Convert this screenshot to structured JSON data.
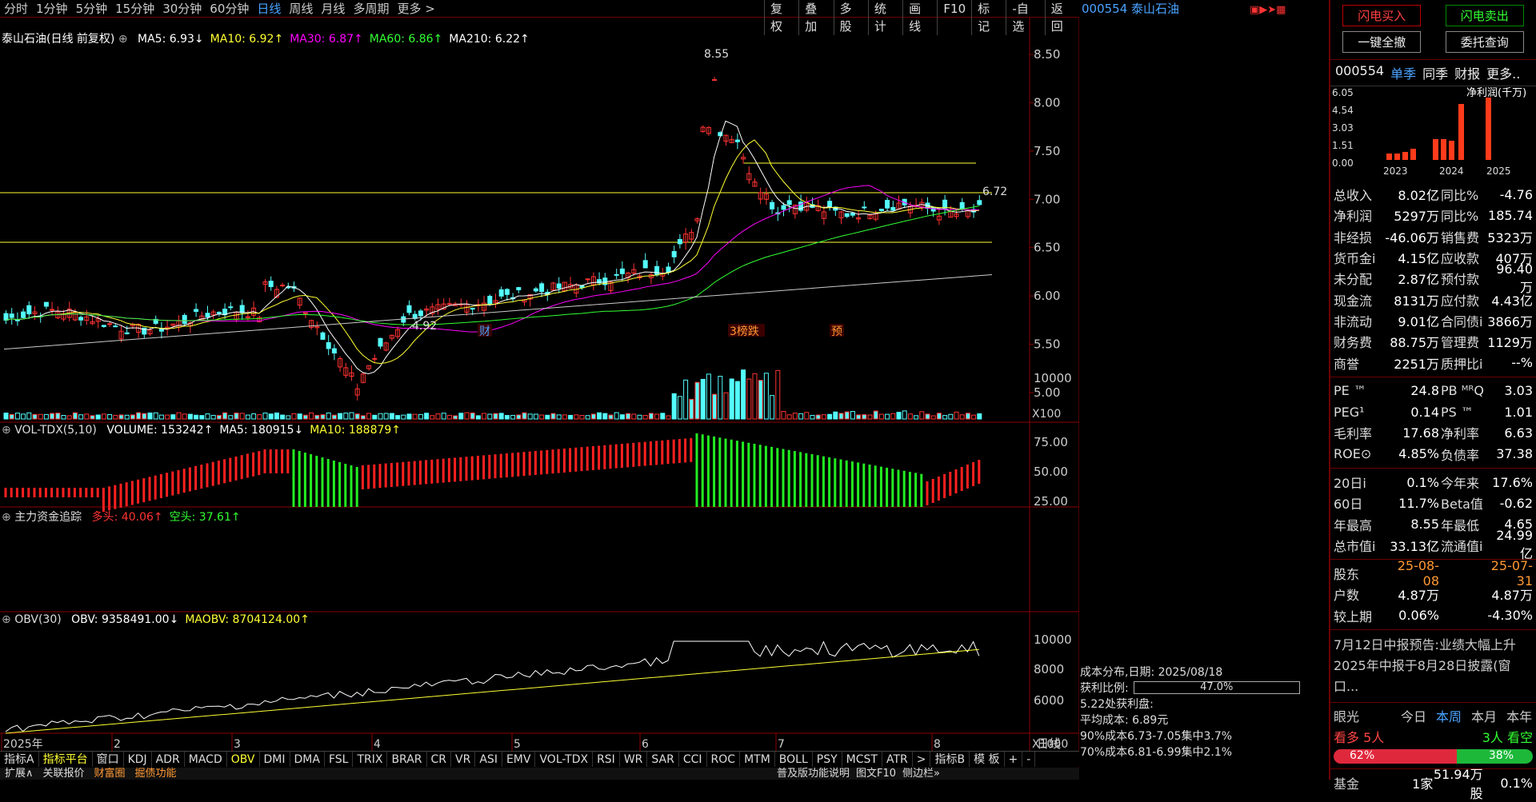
{
  "toolbar": {
    "periods": [
      "分时",
      "1分钟",
      "5分钟",
      "15分钟",
      "30分钟",
      "60分钟",
      "日线",
      "周线",
      "月线",
      "多周期",
      "更多 >"
    ],
    "selected": "日线",
    "tools": [
      "复权",
      "叠加",
      "多股",
      "统计",
      "画线",
      "F10",
      "标记",
      "-自选",
      "返回"
    ]
  },
  "stock": {
    "code": "000554",
    "name": "泰山石油"
  },
  "main_panel": {
    "title": "泰山石油(日线 前复权)",
    "ma": [
      "MA5: 6.93↓",
      "MA10: 6.92↑",
      "MA30: 6.87↑",
      "MA60: 6.86↑",
      "MA210: 6.22↑"
    ],
    "yticks": [
      "8.50",
      "8.00",
      "7.50",
      "7.00",
      "6.50",
      "6.00",
      "5.50",
      "5.00"
    ],
    "high_label": "8.55",
    "low_label": "4.92",
    "price_label": "6.72",
    "markers": [
      "财",
      "3榜跌",
      "预"
    ]
  },
  "vol_panel": {
    "title": "VOL-TDX(5,10)",
    "items": [
      "VOLUME: 153242↑",
      "MA5: 180915↓",
      "MA10: 188879↑"
    ],
    "yticks": [
      "10000"
    ],
    "unit": "X100"
  },
  "money_panel": {
    "title": "主力资金追踪",
    "items": [
      "多头: 40.06↑",
      "空头: 37.61↑"
    ],
    "yticks": [
      "75.00",
      "50.00",
      "25.00"
    ]
  },
  "obv_panel": {
    "title": "OBV(30)",
    "items": [
      "OBV: 9358491.00↓",
      "MAOBV: 8704124.00↑"
    ],
    "yticks": [
      "10000",
      "8000",
      "6000"
    ],
    "unit": "X1000"
  },
  "xaxis": {
    "labels": [
      "2025年",
      "2",
      "3",
      "4",
      "5",
      "6",
      "7",
      "8"
    ],
    "right": "日线"
  },
  "cost": {
    "title": "成本分布,日期: 2025/08/18",
    "ratio_label": "获利比例:",
    "ratio": "47.0%",
    "profit": "5.22处获利盘:",
    "avg": "平均成本: 6.89元",
    "c90": "90%成本6.73-7.05集中3.7%",
    "c70": "70%成本6.81-6.99集中2.1%"
  },
  "sidebar": {
    "buttons": [
      "闪电买入",
      "闪电卖出",
      "一键全撤",
      "委托查询"
    ],
    "tabs": [
      "000554",
      "单季",
      "同季",
      "财报",
      "更多.."
    ],
    "chart": {
      "yticks": [
        "6.05",
        "4.54",
        "3.03",
        "1.51",
        "0.00"
      ],
      "years": [
        "2023",
        "2024",
        "2025"
      ],
      "label": "净利润(千万)"
    },
    "rows": [
      [
        "总收入",
        "8.02亿",
        "同比%",
        "-4.76"
      ],
      [
        "净利润",
        "5297万",
        "同比%",
        "185.74"
      ],
      [
        "非经损",
        "-46.06万",
        "销售费",
        "5323万"
      ],
      [
        "货币金i",
        "4.15亿",
        "应收款",
        "407万"
      ],
      [
        "未分配",
        "2.87亿",
        "预付款",
        "96.40万"
      ],
      [
        "现金流",
        "8131万",
        "应付款",
        "4.43亿"
      ],
      [
        "非流动",
        "9.01亿",
        "合同债i",
        "3866万"
      ],
      [
        "财务费",
        "88.75万",
        "管理费",
        "1129万"
      ],
      [
        "商誉",
        "2251万",
        "质押比i",
        "--%"
      ]
    ],
    "rows2": [
      [
        "PE ™",
        "24.8",
        "PB ᴹᴿQ",
        "3.03"
      ],
      [
        "PEG¹",
        "0.14",
        "PS ™",
        "1.01"
      ],
      [
        "毛利率",
        "17.68",
        "净利率",
        "6.63"
      ],
      [
        "ROE⊙",
        "4.85%",
        "负债率",
        "37.38"
      ]
    ],
    "rows3": [
      [
        "20日i",
        "0.1%",
        "今年来",
        "17.6%"
      ],
      [
        "60日",
        "11.7%",
        "Beta值",
        "-0.62"
      ],
      [
        "年最高",
        "8.55",
        "年最低",
        "4.65"
      ],
      [
        "总市值i",
        "33.13亿",
        "流通值i",
        "24.99亿"
      ]
    ],
    "rows4": [
      [
        "股东",
        "25-08-08",
        "",
        "25-07-31"
      ],
      [
        "户数",
        "4.87万",
        "",
        "4.87万"
      ],
      [
        "较上期",
        "0.06%",
        "",
        "-4.30%"
      ]
    ],
    "news": [
      "7月12日中报预告:业绩大幅上升",
      "2025年中报于8月28日披露(窗口..."
    ],
    "eye": {
      "label": "眼光",
      "tabs": [
        "今日",
        "本周",
        "本月",
        "本年"
      ],
      "bull": "看多 5人",
      "bear": "3人 看空",
      "bull_pct": "62%",
      "bear_pct": "38%"
    },
    "fund": [
      "基金",
      "1家",
      "51.94万股",
      "0.1%"
    ]
  },
  "bottom_tabs": [
    "指标A",
    "指标平台",
    "窗口",
    "KDJ",
    "ADR",
    "MACD",
    "OBV",
    "DMI",
    "DMA",
    "FSL",
    "TRIX",
    "BRAR",
    "CR",
    "VR",
    "ASI",
    "EMV",
    "VOL-TDX",
    "RSI",
    "WR",
    "SAR",
    "CCI",
    "ROC",
    "MTM",
    "BOLL",
    "PSY",
    "MCST",
    "ATR",
    ">",
    "指标B",
    "模 板",
    "+",
    "-"
  ],
  "bottom_tabs2": [
    "扩展∧",
    "关联报价",
    "财富圈",
    "掘债功能"
  ],
  "bottom_right": [
    "普及版功能说明",
    "图文F10",
    "侧边栏»"
  ]
}
